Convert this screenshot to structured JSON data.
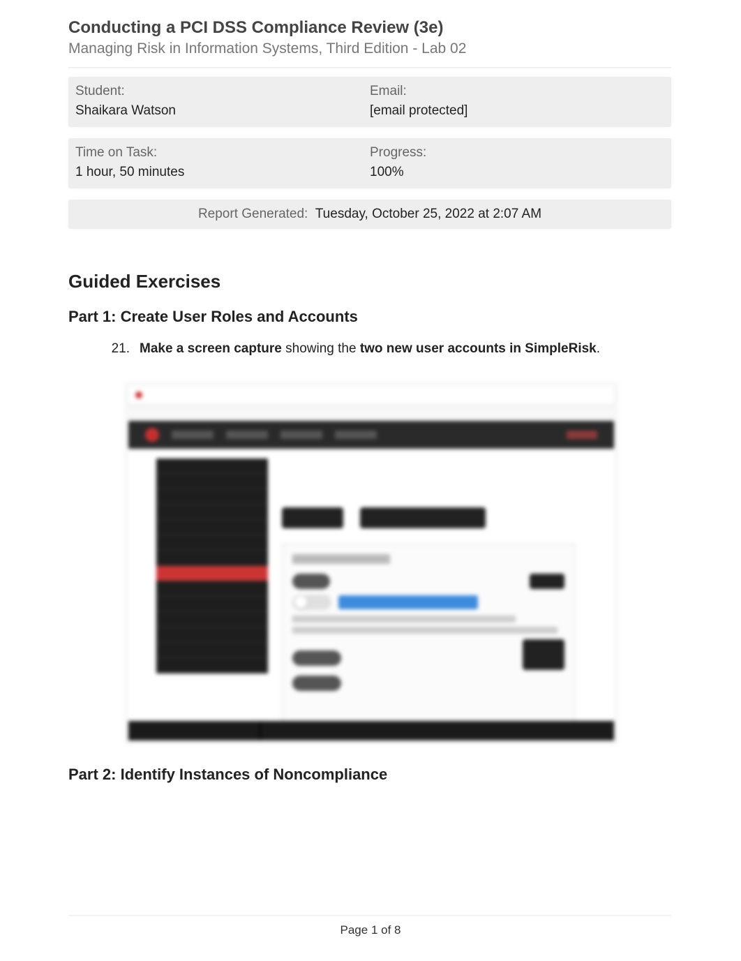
{
  "header": {
    "title": "Conducting a PCI DSS Compliance Review (3e)",
    "subtitle": "Managing Risk in Information Systems, Third Edition - Lab 02"
  },
  "info": {
    "student_label": "Student:",
    "student_value": "Shaikara Watson",
    "email_label": "Email:",
    "email_value": "[email protected]",
    "time_label": "Time on Task:",
    "time_value": "1 hour, 50 minutes",
    "progress_label": "Progress:",
    "progress_value": "100%"
  },
  "report": {
    "label": "Report Generated:",
    "value": "Tuesday, October 25, 2022 at 2:07 AM"
  },
  "sections": {
    "guided": "Guided Exercises",
    "part1": "Part 1: Create User Roles and Accounts",
    "part2": "Part 2: Identify Instances of Noncompliance"
  },
  "task": {
    "number": "21.",
    "bold1": "Make a screen capture",
    "mid": " showing the ",
    "bold2": "two new user accounts in SimpleRisk",
    "end": "."
  },
  "footer": {
    "page": "Page 1 of 8"
  }
}
